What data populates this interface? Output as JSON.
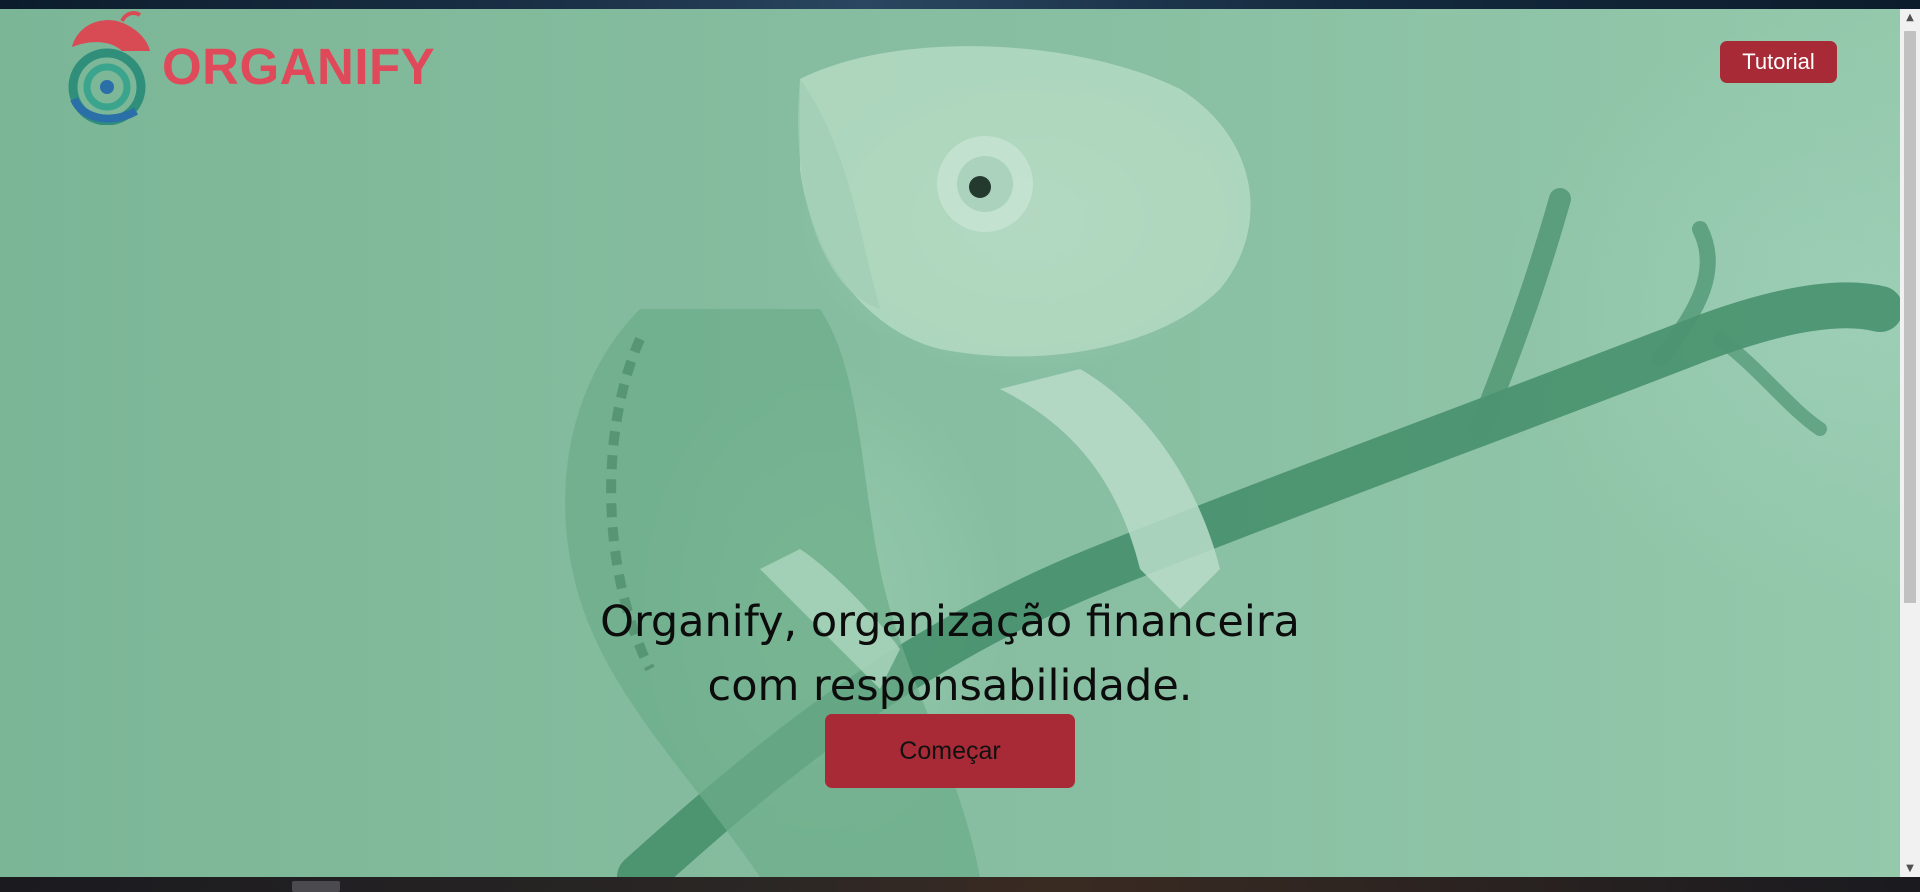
{
  "header": {
    "brand": "ORGANIFY",
    "logo_icon": "chameleon-spiral-logo",
    "tutorial_label": "Tutorial"
  },
  "hero": {
    "headline_line1": "Organify, organização financeira",
    "headline_line2": "com responsabilidade.",
    "start_label": "Começar"
  },
  "colors": {
    "accent": "#a82a36",
    "brand_text": "#e0495a",
    "background": "#8ec2a6"
  }
}
